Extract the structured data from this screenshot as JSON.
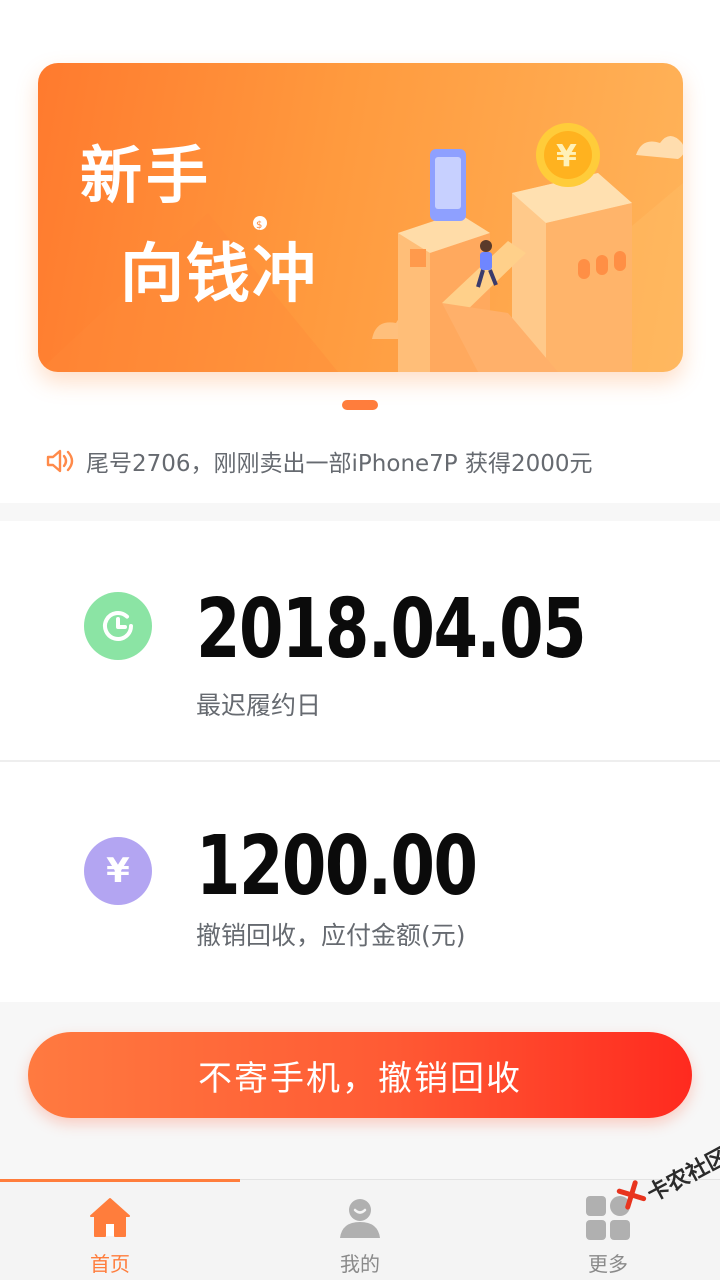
{
  "banner": {
    "title_line1": "新手",
    "title_line2": "向钱冲",
    "colors": {
      "start": "#ff7a2e",
      "end": "#ffb45a"
    }
  },
  "notice": {
    "icon": "speaker-icon",
    "text": "尾号2706，刚刚卖出一部iPhone7P 获得2000元"
  },
  "due_card": {
    "icon": "clock-icon",
    "value": "2018.04.05",
    "label": "最迟履约日"
  },
  "amount_card": {
    "icon": "yuan-icon",
    "icon_glyph": "¥",
    "value": "1200.00",
    "label": "撤销回收，应付金额(元)"
  },
  "cta": {
    "label": "不寄手机，撤销回收"
  },
  "tabbar": {
    "tabs": [
      {
        "label": "首页",
        "icon": "home-icon",
        "active": true
      },
      {
        "label": "我的",
        "icon": "profile-icon",
        "active": false
      },
      {
        "label": "更多",
        "icon": "grid-icon",
        "active": false
      }
    ]
  },
  "watermark": {
    "text": "卡农社区"
  },
  "colors": {
    "accent": "#ff7d3c",
    "cta_end": "#ff2a1f",
    "green": "#8be4a4",
    "purple": "#b3a5f2"
  }
}
